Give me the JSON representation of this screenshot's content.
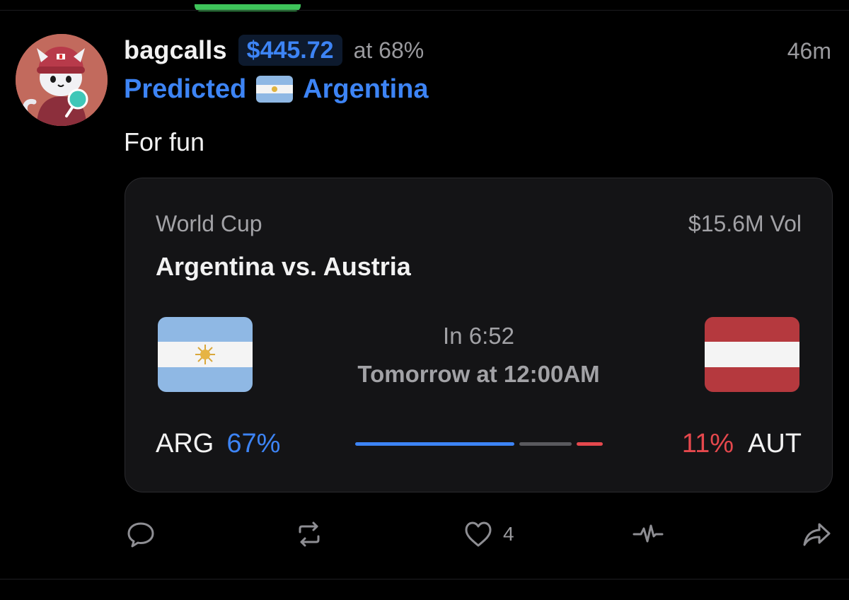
{
  "post": {
    "username": "bagcalls",
    "amount": "$445.72",
    "at_text": "at 68%",
    "time_ago": "46m",
    "predicted_label": "Predicted",
    "predicted_team": "Argentina",
    "text": "For fun"
  },
  "market": {
    "league": "World Cup",
    "volume": "$15.6M Vol",
    "title": "Argentina vs. Austria",
    "countdown": "In 6:52",
    "start_time": "Tomorrow at 12:00AM",
    "home": {
      "abbr": "ARG",
      "pct": "67%",
      "flag_icon": "argentina-flag-icon"
    },
    "away": {
      "abbr": "AUT",
      "pct": "11%",
      "flag_icon": "austria-flag-icon"
    },
    "probabilities": {
      "home": 0.67,
      "draw": 0.22,
      "away": 0.11
    }
  },
  "actions": {
    "reply_icon": "comment-icon",
    "repost_icon": "repost-icon",
    "like_icon": "heart-icon",
    "like_count": "4",
    "activity_icon": "activity-icon",
    "share_icon": "share-icon"
  },
  "colors": {
    "accent_blue": "#3d84f5",
    "away_red": "#e5484d",
    "draw_gray": "#5a5a5e",
    "background": "#000000",
    "card_bg": "#141416"
  }
}
